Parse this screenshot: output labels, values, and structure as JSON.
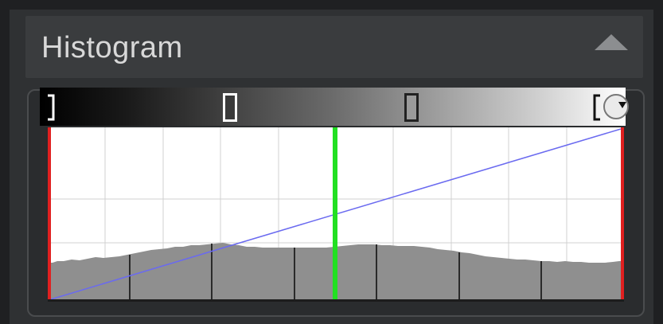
{
  "panel": {
    "title": "Histogram",
    "collapse_icon": "triangle-up-icon"
  },
  "levels": {
    "black_point_icon": "bracket-left-icon",
    "white_point_icon": "bracket-right-icon",
    "dropdown_icon": "chevron-down-icon"
  },
  "colors": {
    "clip_marker": "#e02020",
    "midpoint_line": "#22e022",
    "curve_line": "#6a6af0",
    "histogram_fill": "#8f8f8f",
    "background": "#2f3133"
  }
}
